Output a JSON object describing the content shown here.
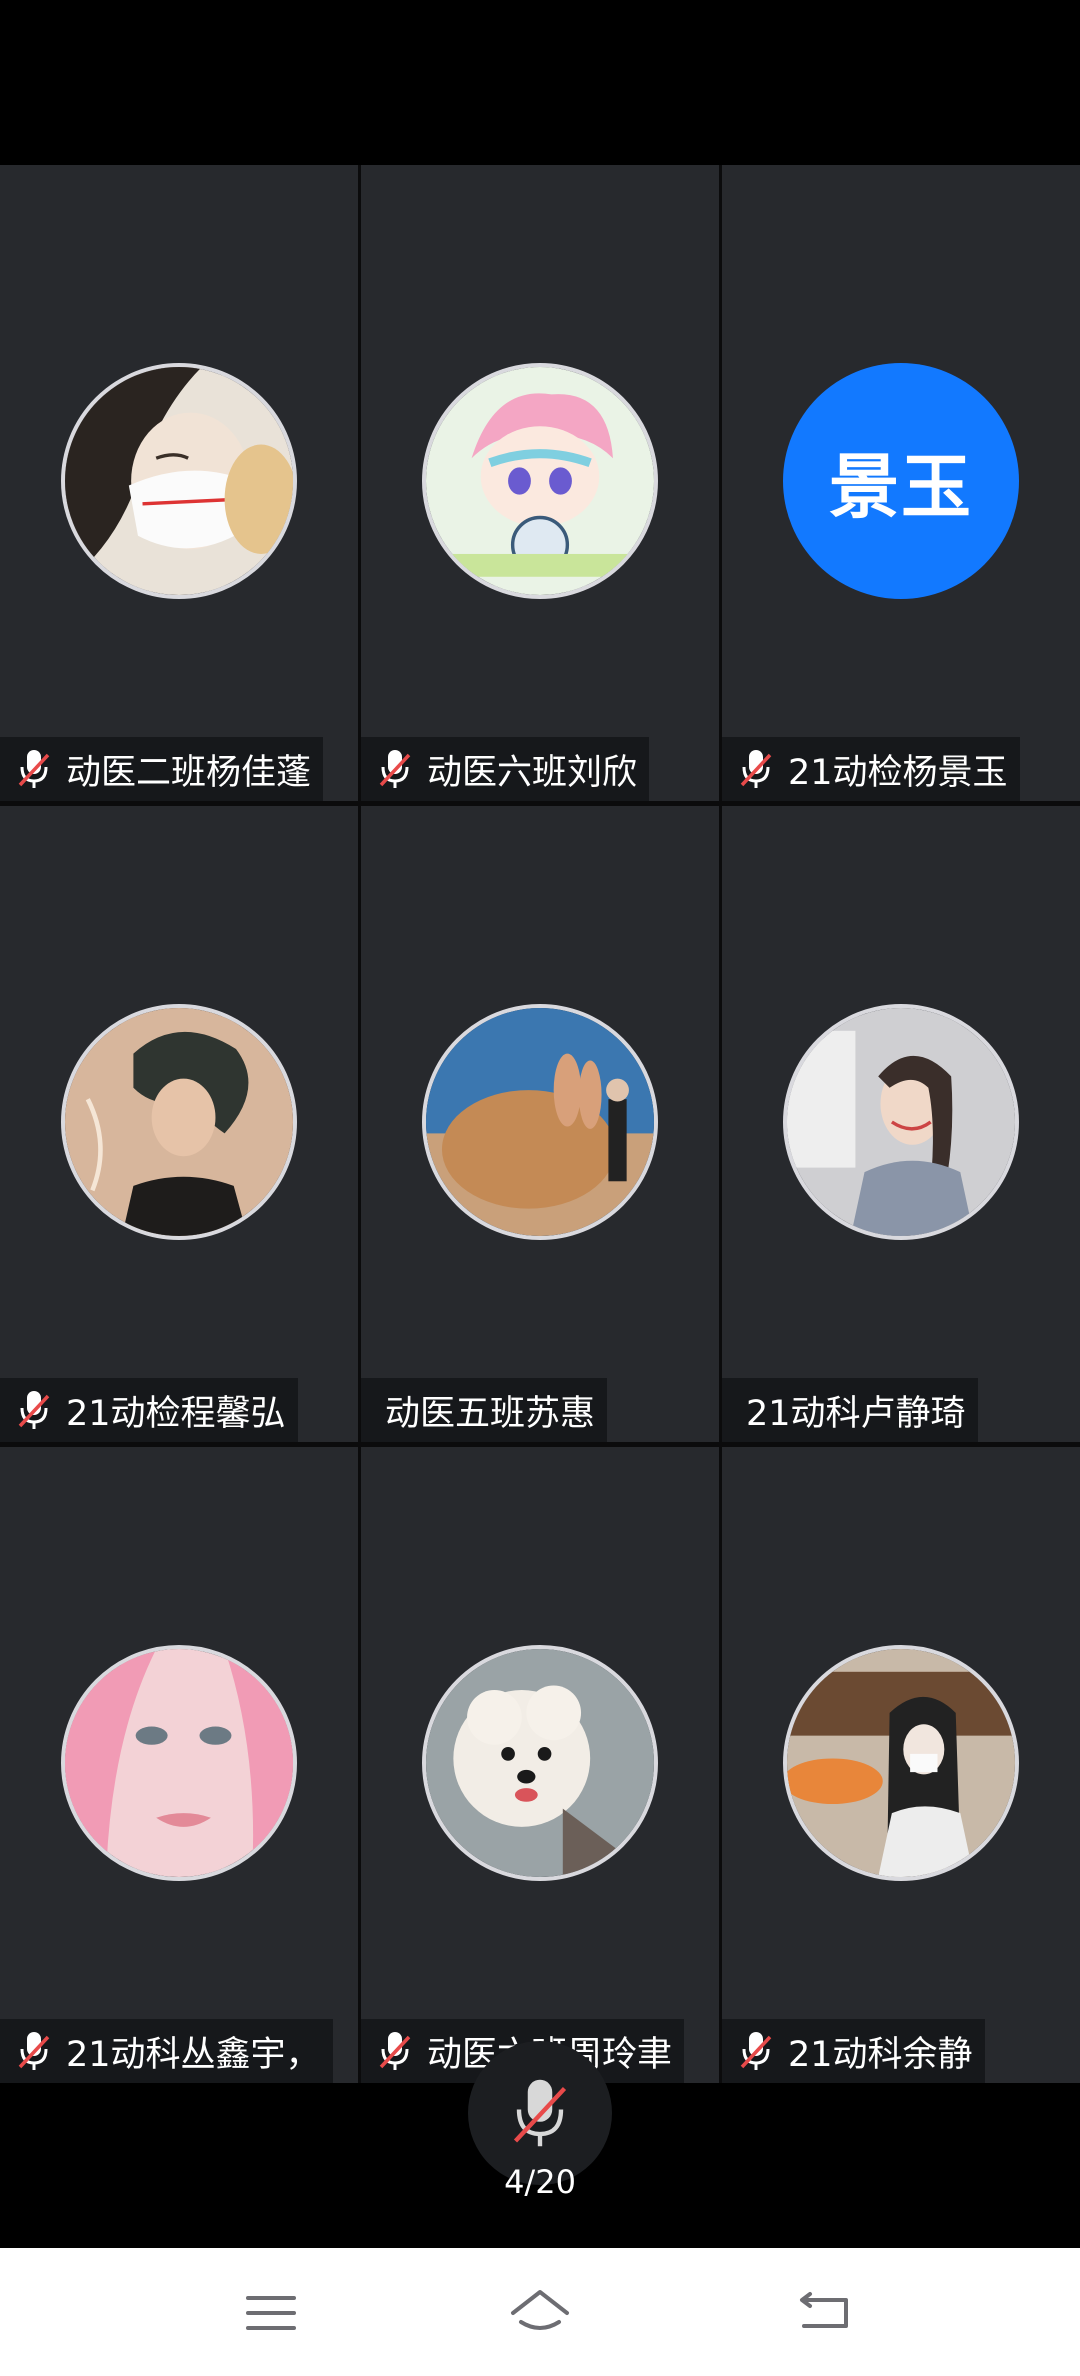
{
  "participants": [
    {
      "name": "动医二班杨佳蓬",
      "muted": true,
      "avatar": "photo-masked-girl"
    },
    {
      "name": "动医六班刘欣",
      "muted": true,
      "avatar": "anime-boy-pink-hair"
    },
    {
      "name": "21动检杨景玉",
      "muted": true,
      "avatar_text": "景玉",
      "avatar_color": "#1279ff"
    },
    {
      "name": "21动检程馨弘",
      "muted": true,
      "avatar": "illustrated-dark-hair"
    },
    {
      "name": "动医五班苏惠",
      "muted": false,
      "avatar": "rabbit-photo"
    },
    {
      "name": "21动科卢静琦",
      "muted": false,
      "avatar": "smiling-girl-braid"
    },
    {
      "name": "21动科丛鑫宇，",
      "muted": true,
      "avatar": "pink-hair-portrait"
    },
    {
      "name": "动医六班周玲聿",
      "muted": true,
      "avatar": "white-poodle"
    },
    {
      "name": "21动科余静",
      "muted": true,
      "avatar": "street-girl-photo"
    }
  ],
  "controls": {
    "mic_state": "muted",
    "page_indicator": "4/20"
  },
  "navbar": {
    "menu_icon": "menu-icon",
    "home_icon": "home-icon",
    "back_icon": "back-icon"
  }
}
